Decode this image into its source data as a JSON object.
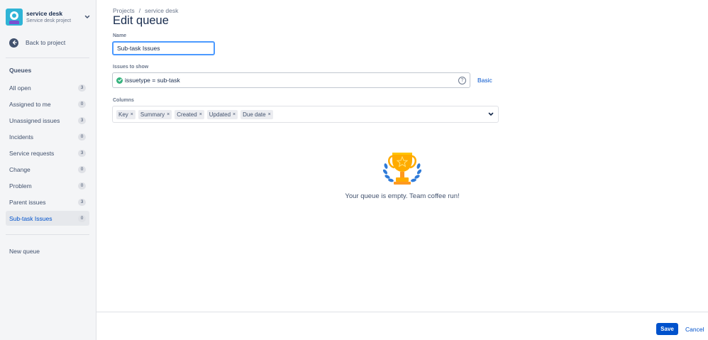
{
  "sidebar": {
    "project": {
      "name": "service desk",
      "type": "Service desk project",
      "avatar_color": "#2fb4d6"
    },
    "back_label": "Back to project",
    "queues_heading": "Queues",
    "queues": [
      {
        "label": "All open",
        "count": "3"
      },
      {
        "label": "Assigned to me",
        "count": "0"
      },
      {
        "label": "Unassigned issues",
        "count": "3"
      },
      {
        "label": "Incidents",
        "count": "0"
      },
      {
        "label": "Service requests",
        "count": "3"
      },
      {
        "label": "Change",
        "count": "0"
      },
      {
        "label": "Problem",
        "count": "0"
      },
      {
        "label": "Parent issues",
        "count": "3"
      },
      {
        "label": "Sub-task Issues",
        "count": "0",
        "active": true
      }
    ],
    "new_queue_label": "New queue"
  },
  "breadcrumb": {
    "items": [
      "Projects",
      "service desk"
    ],
    "separator": "/"
  },
  "page_title": "Edit queue",
  "form": {
    "name_label": "Name",
    "name_value": "Sub-task Issues",
    "issues_label": "Issues to show",
    "jql_value": "issuetype = sub-task",
    "help_glyph": "?",
    "basic_link": "Basic",
    "columns_label": "Columns",
    "columns": [
      "Key",
      "Summary",
      "Created",
      "Updated",
      "Due date"
    ],
    "remove_glyph": "×"
  },
  "empty_state": {
    "message": "Your queue is empty. Team coffee run!",
    "icon": "trophy-icon"
  },
  "footer": {
    "save_label": "Save",
    "cancel_label": "Cancel"
  },
  "colors": {
    "accent": "#0052cc",
    "focus": "#4c9aff",
    "valid": "#36b37e",
    "trophy": "#ffab00"
  }
}
